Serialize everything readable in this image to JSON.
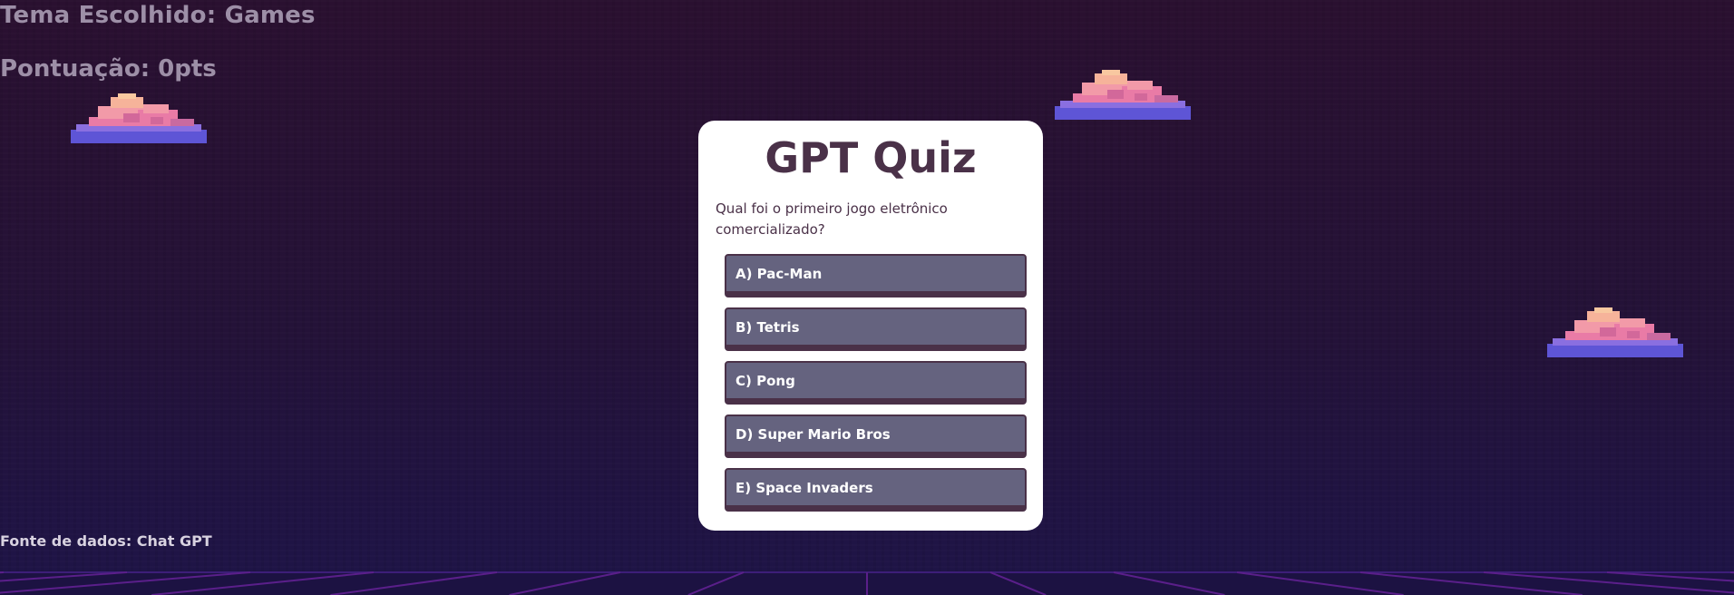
{
  "header": {
    "topic_text": "Tema Escolhido: Games",
    "score_text": "Pontuação: 0pts"
  },
  "quiz": {
    "title": "GPT Quiz",
    "question": "Qual foi o primeiro jogo eletrônico comercializado?",
    "options": [
      "A) Pac-Man",
      "B) Tetris",
      "C) Pong",
      "D) Super Mario Bros",
      "E) Space Invaders"
    ]
  },
  "footer": {
    "source_text": "Fonte de dados: Chat GPT"
  },
  "decor": {
    "cloud_icon": "pixel-cloud-icon",
    "colors": {
      "background_top": "#2a1030",
      "background_bottom": "#1e1448",
      "card": "#ffffff",
      "title_text": "#4a3148",
      "option_bg": "#65637f",
      "option_border": "#4a3148",
      "header_text": "#9d8fa7",
      "grid_line": "#5a1f8a"
    }
  }
}
